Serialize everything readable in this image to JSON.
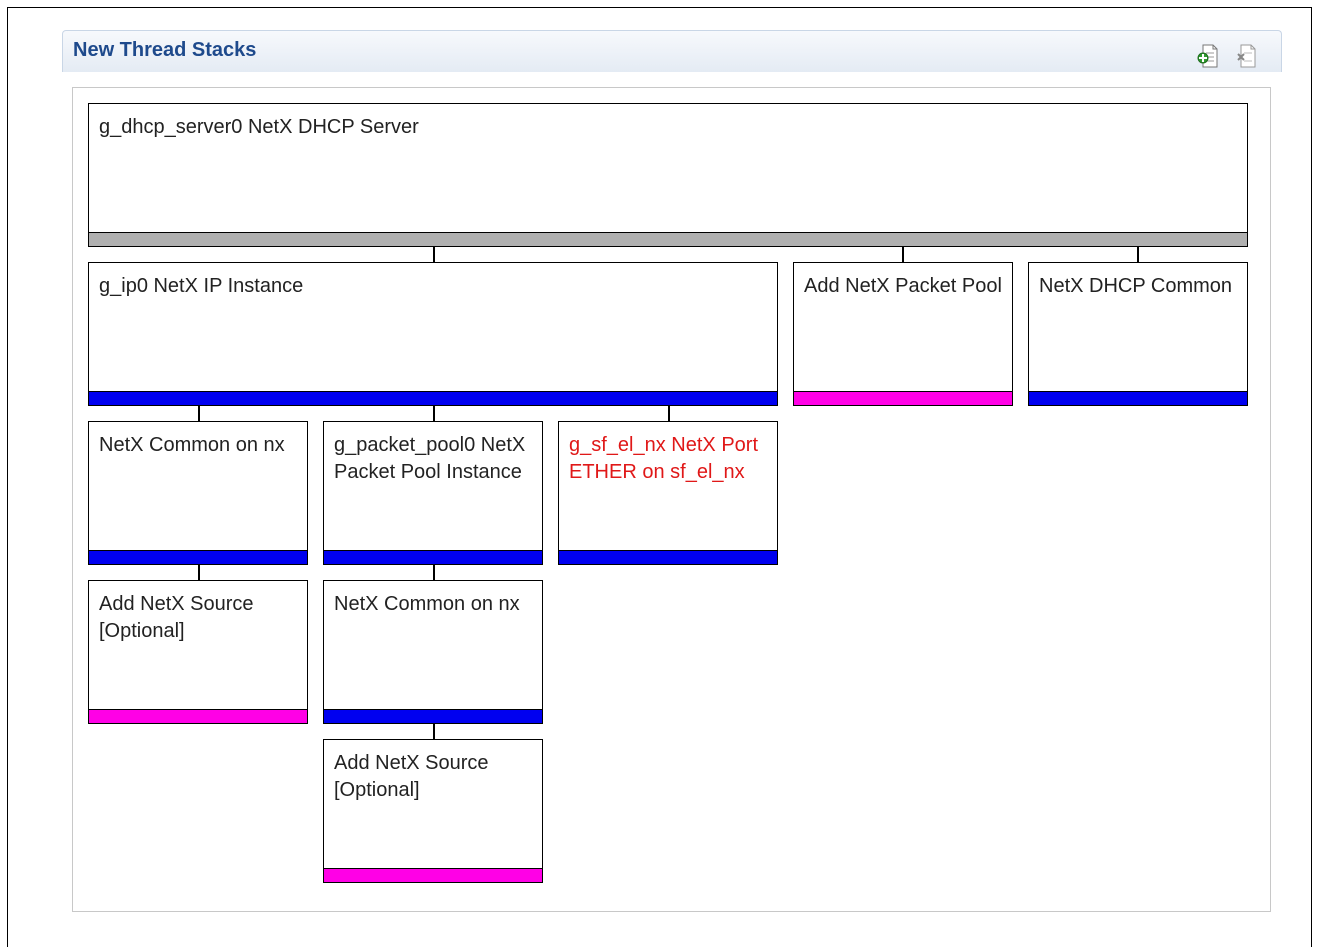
{
  "panel": {
    "title": "New Thread Stacks"
  },
  "icons": {
    "add_stack": "add-stack-icon",
    "remove_stack": "remove-stack-icon"
  },
  "colors": {
    "title": "#1e4a8c",
    "bar_required": "#0000f0",
    "bar_optional": "#ff00e6",
    "bar_root": "#b0b0b0",
    "error_text": "#e01818"
  },
  "nodes": {
    "dhcp_server": {
      "label": "g_dhcp_server0 NetX DHCP Server",
      "bar": "gray"
    },
    "ip_instance": {
      "label": "g_ip0 NetX IP Instance",
      "bar": "blue"
    },
    "add_packet_pool": {
      "label": "Add NetX Packet Pool",
      "bar": "magenta"
    },
    "dhcp_common": {
      "label": "NetX DHCP Common",
      "bar": "blue"
    },
    "netx_common_1": {
      "label": "NetX Common on nx",
      "bar": "blue"
    },
    "packet_pool_instance": {
      "label": "g_packet_pool0 NetX Packet Pool Instance",
      "bar": "blue"
    },
    "port_ether": {
      "label": "g_sf_el_nx NetX Port ETHER on sf_el_nx",
      "bar": "blue",
      "error": true
    },
    "add_source_1": {
      "label": "Add NetX Source [Optional]",
      "bar": "magenta"
    },
    "netx_common_2": {
      "label": "NetX Common on nx",
      "bar": "blue"
    },
    "add_source_2": {
      "label": "Add NetX Source [Optional]",
      "bar": "magenta"
    }
  }
}
